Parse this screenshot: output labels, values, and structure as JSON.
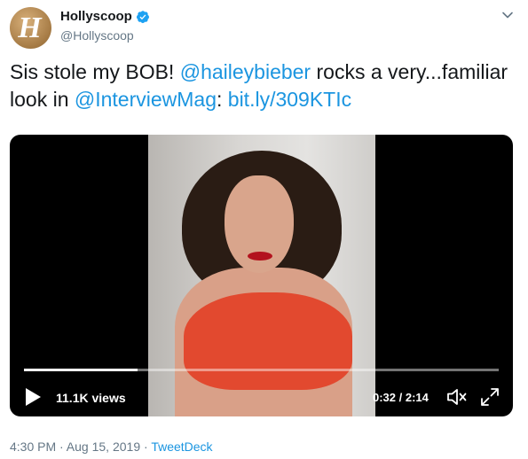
{
  "author": {
    "avatar_letter": "H",
    "display_name": "Hollyscoop",
    "handle": "@Hollyscoop",
    "verified": true
  },
  "menu_icon": "chevron-down-icon",
  "tweet": {
    "text_1": "Sis stole my BOB! ",
    "mention_1": "@haileybieber",
    "text_2": " rocks a very...familiar look in ",
    "mention_2": "@InterviewMag",
    "text_3": ": ",
    "link": "bit.ly/309KTIc"
  },
  "video": {
    "progress_fraction": 0.24,
    "views": "11.1K views",
    "time": "0:32 / 2:14",
    "icons": [
      "play-icon",
      "volume-icon",
      "fullscreen-icon"
    ]
  },
  "meta": {
    "timestamp": "4:30 PM · Aug 15, 2019",
    "separator": " · ",
    "app": "TweetDeck"
  },
  "colors": {
    "link": "#1b95e0",
    "secondary": "#657786",
    "text": "#14171a"
  }
}
